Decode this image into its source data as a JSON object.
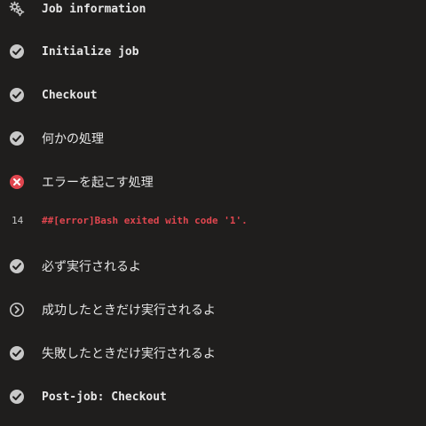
{
  "steps": [
    {
      "label": "Job information",
      "status": "settings",
      "icon": "gears-icon"
    },
    {
      "label": "Initialize job",
      "status": "success",
      "icon": "check-circle-icon"
    },
    {
      "label": "Checkout",
      "status": "success",
      "icon": "check-circle-icon"
    },
    {
      "label": "何かの処理",
      "status": "success",
      "icon": "check-circle-icon"
    },
    {
      "label": "エラーを起こす処理",
      "status": "failure",
      "icon": "x-circle-icon"
    },
    {
      "label": "必ず実行されるよ",
      "status": "success",
      "icon": "check-circle-icon"
    },
    {
      "label": "成功したときだけ実行されるよ",
      "status": "skipped",
      "icon": "chevron-circle-icon"
    },
    {
      "label": "失敗したときだけ実行されるよ",
      "status": "success",
      "icon": "check-circle-icon"
    },
    {
      "label": "Post-job: Checkout",
      "status": "success",
      "icon": "check-circle-icon"
    }
  ],
  "error_log": {
    "line_number": "14",
    "text": "##[error]Bash exited with code '1'."
  },
  "colors": {
    "background": "#1f1e1d",
    "success_icon": "#c8c8c8",
    "failure_icon": "#e0464f",
    "error_text": "#e0464f"
  }
}
